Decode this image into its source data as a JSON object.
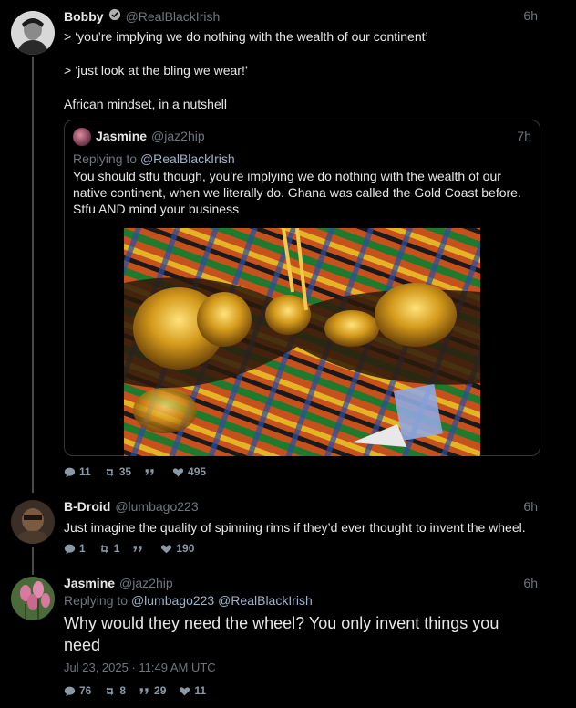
{
  "tweet1": {
    "name": "Bobby",
    "handle": "@RealBlackIrish",
    "time": "6h",
    "lines": [
      "> ‘you’re implying we do nothing with the wealth of our continent’",
      "> ‘just look at the bling we wear!’",
      "African mindset, in a nutshell"
    ],
    "stats": {
      "replies": "11",
      "retweets": "35",
      "quotes": "",
      "likes": "495"
    }
  },
  "quote": {
    "name": "Jasmine",
    "handle": "@jaz2hip",
    "time": "7h",
    "replying_label": "Replying to",
    "replying_to": "@RealBlackIrish",
    "text": "You should stfu though, you're implying we do nothing with the wealth of our native continent, when we literally do. Ghana was called the Gold Coast before. Stfu AND mind your business"
  },
  "tweet2": {
    "name": "B-Droid",
    "handle": "@lumbago223",
    "time": "6h",
    "text": "Just imagine the quality of spinning rims if they’d ever thought to invent the wheel.",
    "stats": {
      "replies": "1",
      "retweets": "1",
      "quotes": "",
      "likes": "190"
    }
  },
  "tweet3": {
    "name": "Jasmine",
    "handle": "@jaz2hip",
    "time": "6h",
    "replying_label": "Replying to",
    "replying_to": "@lumbago223 @RealBlackIrish",
    "text": "Why would they need the wheel? You only invent things you need",
    "timestamp": "Jul 23, 2025 · 11:49 AM UTC",
    "stats": {
      "replies": "76",
      "retweets": "8",
      "quotes": "29",
      "likes": "11"
    }
  },
  "colors": {
    "background": "#000000",
    "text": "#e7e7e7",
    "muted": "#6e767d",
    "link": "#9fb4c9",
    "border": "#333639"
  }
}
